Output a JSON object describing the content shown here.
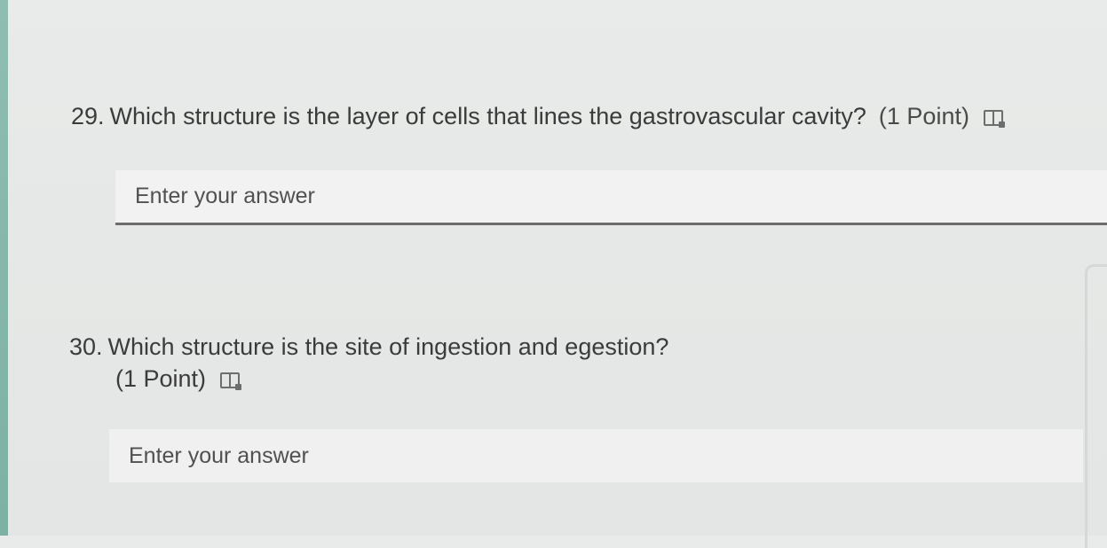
{
  "colors": {
    "background": "#e7e9e8",
    "accent_strip": "#86b5a9",
    "text": "#3b3b3b",
    "input_background": "#f1f2f1",
    "input_underline": "#6c6c6c"
  },
  "questions": [
    {
      "number": "29.",
      "text": "Which structure is the layer of cells that lines the gastrovascular cavity?",
      "points": "(1 Point)",
      "icon": "immersive-reader-icon",
      "answer_placeholder": "Enter your answer",
      "answer_value": ""
    },
    {
      "number": "30.",
      "text": "Which structure is the site of ingestion and egestion?",
      "points": "(1 Point)",
      "icon": "immersive-reader-icon",
      "answer_placeholder": "Enter your answer",
      "answer_value": ""
    }
  ]
}
